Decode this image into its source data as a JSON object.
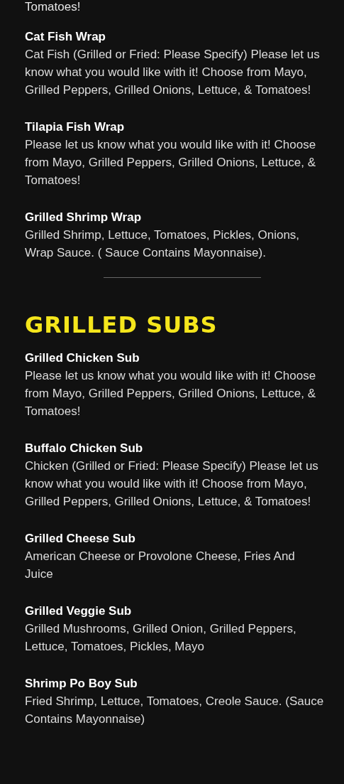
{
  "cut_text": "Tomatoes!",
  "sections": [
    {
      "items": [
        {
          "name": "Cat Fish Wrap",
          "description": "Cat Fish (Grilled or Fried: Please Specify) Please let us know what you would like with it! Choose from Mayo, Grilled Peppers, Grilled Onions, Lettuce, & Tomatoes!"
        },
        {
          "name": "Tilapia Fish Wrap",
          "description": "Please let us know what you would like with it! Choose from Mayo, Grilled Peppers, Grilled Onions, Lettuce, & Tomatoes!"
        },
        {
          "name": "Grilled Shrimp Wrap",
          "description": "Grilled Shrimp, Lettuce, Tomatoes, Pickles, Onions, Wrap Sauce. ( Sauce Contains Mayonnaise)."
        }
      ]
    },
    {
      "title": "GRILLED SUBS",
      "items": [
        {
          "name": "Grilled Chicken Sub",
          "description": "Please let us know what you would like with it! Choose from Mayo, Grilled Peppers, Grilled Onions, Lettuce, & Tomatoes!"
        },
        {
          "name": "Buffalo Chicken Sub",
          "description": "Chicken (Grilled or Fried: Please Specify) Please let us know what you would like with it! Choose from Mayo, Grilled Peppers, Grilled Onions, Lettuce, & Tomatoes!"
        },
        {
          "name": "Grilled Cheese Sub",
          "description": "American Cheese or Provolone Cheese, Fries And Juice"
        },
        {
          "name": "Grilled Veggie Sub",
          "description": "Grilled Mushrooms, Grilled Onion, Grilled Peppers, Lettuce, Tomatoes, Pickles, Mayo"
        },
        {
          "name": "Shrimp Po Boy Sub",
          "description": "Fried Shrimp, Lettuce, Tomatoes, Creole Sauce. (Sauce Contains Mayonnaise)"
        }
      ]
    }
  ]
}
